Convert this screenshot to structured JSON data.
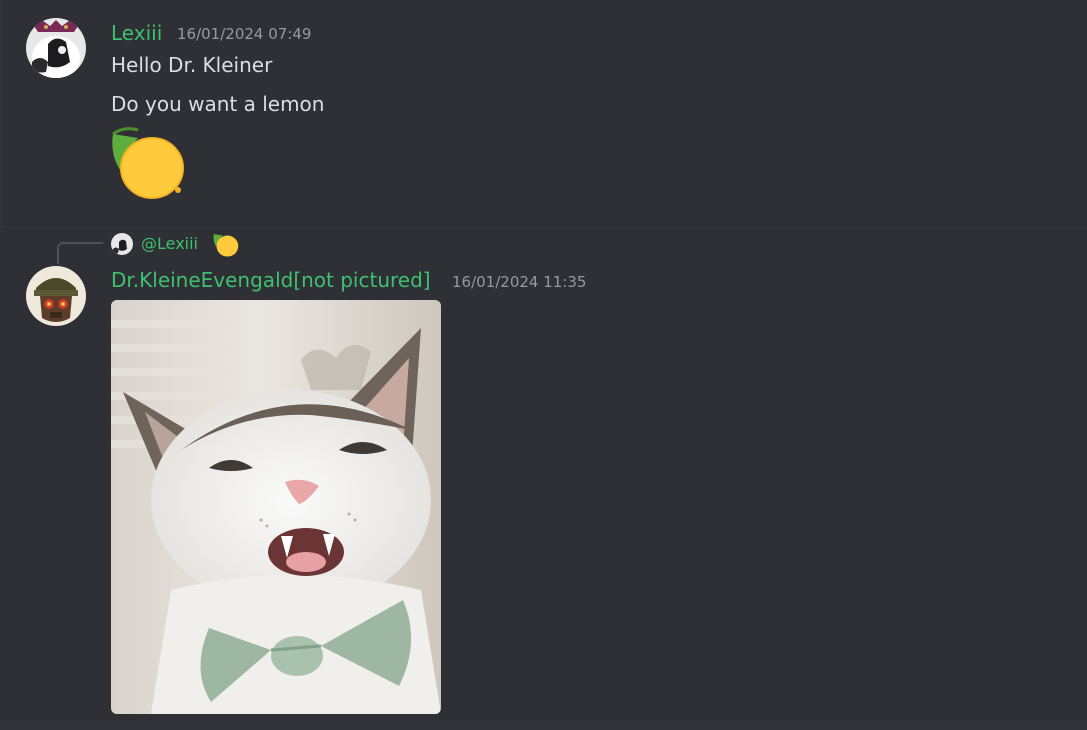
{
  "messages": [
    {
      "author": "Lexiii",
      "timestamp": "16/01/2024 07:49",
      "lines": [
        "Hello Dr. Kleiner",
        "Do you want a lemon"
      ],
      "emoji_icon": "lemon-icon"
    },
    {
      "author": "Dr.KleineEvengald[not pictured]",
      "timestamp": "16/01/2024 11:35",
      "reply": {
        "mention": "@Lexiii",
        "emoji_icon": "lemon-icon"
      },
      "attachment_icon": "cat-gif-image"
    }
  ],
  "colors": {
    "background": "#313338",
    "username": "#3ec06f",
    "text": "#dbdee1",
    "timestamp": "#949ba4"
  }
}
